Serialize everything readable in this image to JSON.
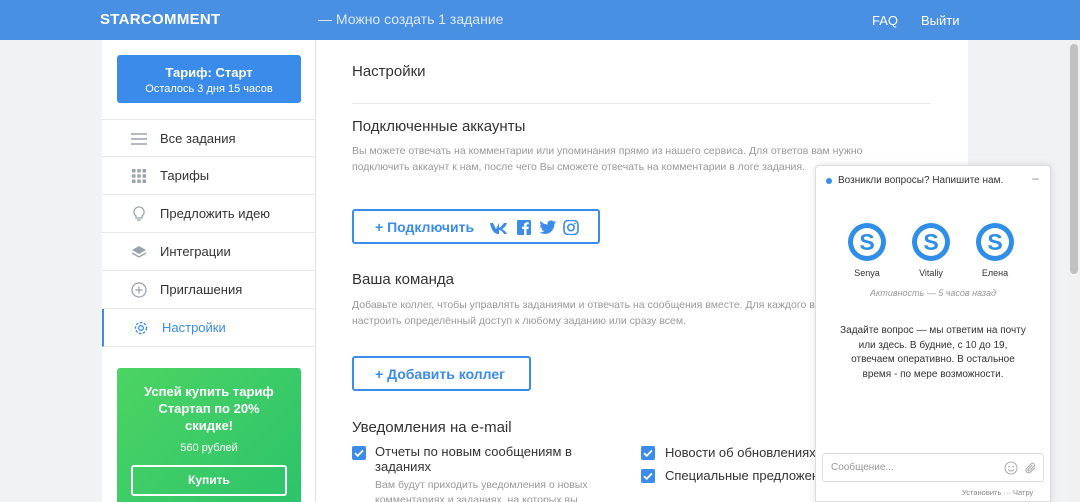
{
  "topbar": {
    "logo": "STARCOMMENT",
    "note": "— Можно создать 1 задание",
    "faq": "FAQ",
    "exit": "Выйти",
    "color": "#4a90e2"
  },
  "sidebar": {
    "plan": {
      "title": "Тариф: Старт",
      "subtitle": "Осталось 3 дня 15 часов"
    },
    "items": [
      {
        "label": "Все задания",
        "icon": "list-icon"
      },
      {
        "label": "Тарифы",
        "icon": "grid-icon"
      },
      {
        "label": "Предложить идею",
        "icon": "lightbulb-icon"
      },
      {
        "label": "Интеграции",
        "icon": "layers-icon"
      },
      {
        "label": "Приглашения",
        "icon": "plus-circle-icon"
      },
      {
        "label": "Настройки",
        "icon": "gear-icon",
        "active": true
      }
    ],
    "promo": {
      "title": "Успей купить тариф Стартап по 20% скидке!",
      "price": "560 рублей",
      "button": "Купить"
    }
  },
  "main": {
    "title": "Настройки",
    "accounts": {
      "title": "Подключенные аккаунты",
      "desc": "Вы можете отвечать на комментарии или упоминания прямо из нашего сервиса. Для ответов вам нужно подключить аккаунт к нам, после чего Вы сможете отвечать на комментарии в логе задания.",
      "button": "+ Подключить",
      "socials": [
        "vk-icon",
        "facebook-icon",
        "twitter-icon",
        "instagram-icon"
      ]
    },
    "team": {
      "title": "Ваша команда",
      "desc": "Добавьте коллег, чтобы управлять заданиями и отвечать на сообщения вместе. Для каждого вы сможете настроить определённый доступ к любому заданию или сразу всем.",
      "button": "+ Добавить коллег"
    },
    "notifications": {
      "title": "Уведомления на e-mail",
      "left": {
        "label": "Отчеты по новым сообщениям в заданиях",
        "sub": "Вам будут приходить уведомления о новых комментариях и заданиях, на которых вы"
      },
      "right": [
        {
          "label": "Новости об обновлениях"
        },
        {
          "label": "Специальные предложения"
        }
      ]
    }
  },
  "chat": {
    "header": "Возникли вопросы? Напишите нам.",
    "minimize": "–",
    "agents": [
      {
        "name": "Senya"
      },
      {
        "name": "Vitaliy"
      },
      {
        "name": "Елена"
      }
    ],
    "activity": "Активность — 5 часов назад",
    "text": "Задайте вопрос — мы ответим на почту или здесь. В будние, с 10 до 19, отвечаем оперативно. В остальное время - по мере возможности.",
    "input_placeholder": "Сообщение...",
    "footer": "Установить ··· Чатру"
  }
}
